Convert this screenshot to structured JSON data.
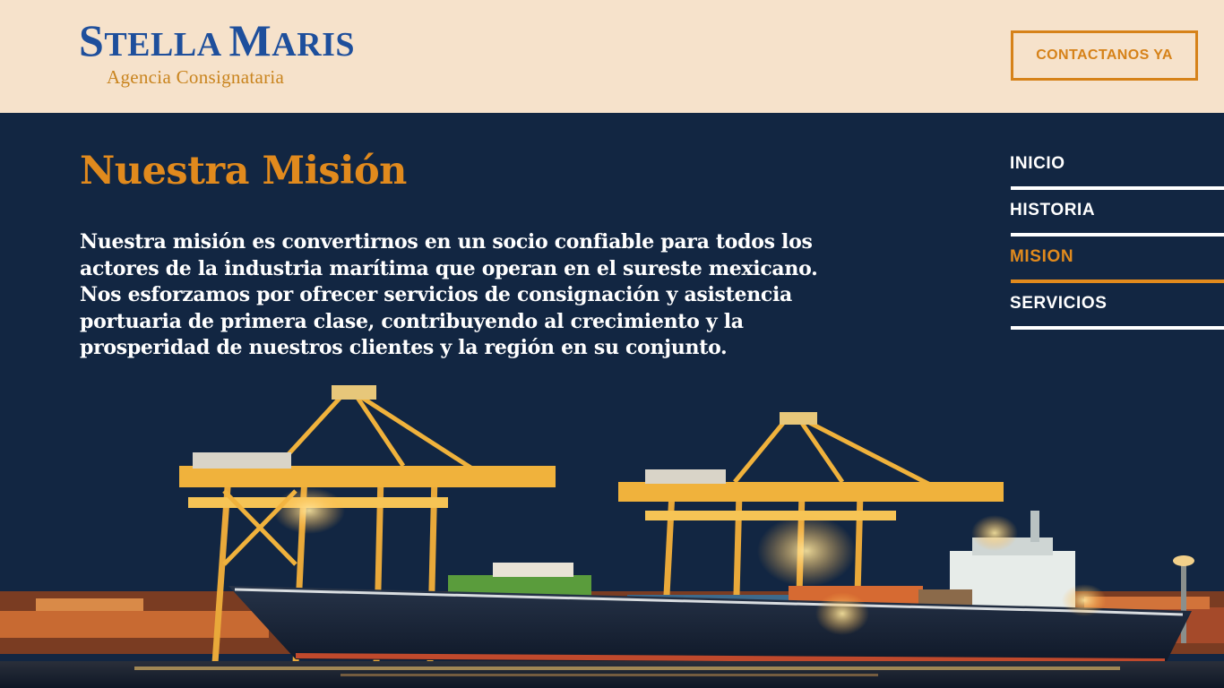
{
  "header": {
    "logo": {
      "title_initial_1": "S",
      "title_rest_1": "TELLA ",
      "title_initial_2": "M",
      "title_rest_2": "ARIS",
      "subtitle": "Agencia Consignataria"
    },
    "cta_label": "CONTACTANOS YA"
  },
  "main": {
    "title": "Nuestra Misión",
    "body": "Nuestra misión es convertirnos en un socio confiable para todos los actores de la industria marítima que operan en el sureste mexicano. Nos esforzamos por ofrecer servicios de consignación y asistencia portuaria de primera clase, contribuyendo al crecimiento y la prosperidad de nuestros clientes y la región en su conjunto."
  },
  "nav": {
    "items": [
      {
        "label": "INICIO",
        "active": false
      },
      {
        "label": "HISTORIA",
        "active": false
      },
      {
        "label": "MISION",
        "active": true
      },
      {
        "label": "SERVICIOS",
        "active": false
      }
    ]
  },
  "colors": {
    "header_bg": "#f6e2cb",
    "page_bg": "#122642",
    "accent": "#e18a1d",
    "logo_blue": "#1e4f9c"
  }
}
